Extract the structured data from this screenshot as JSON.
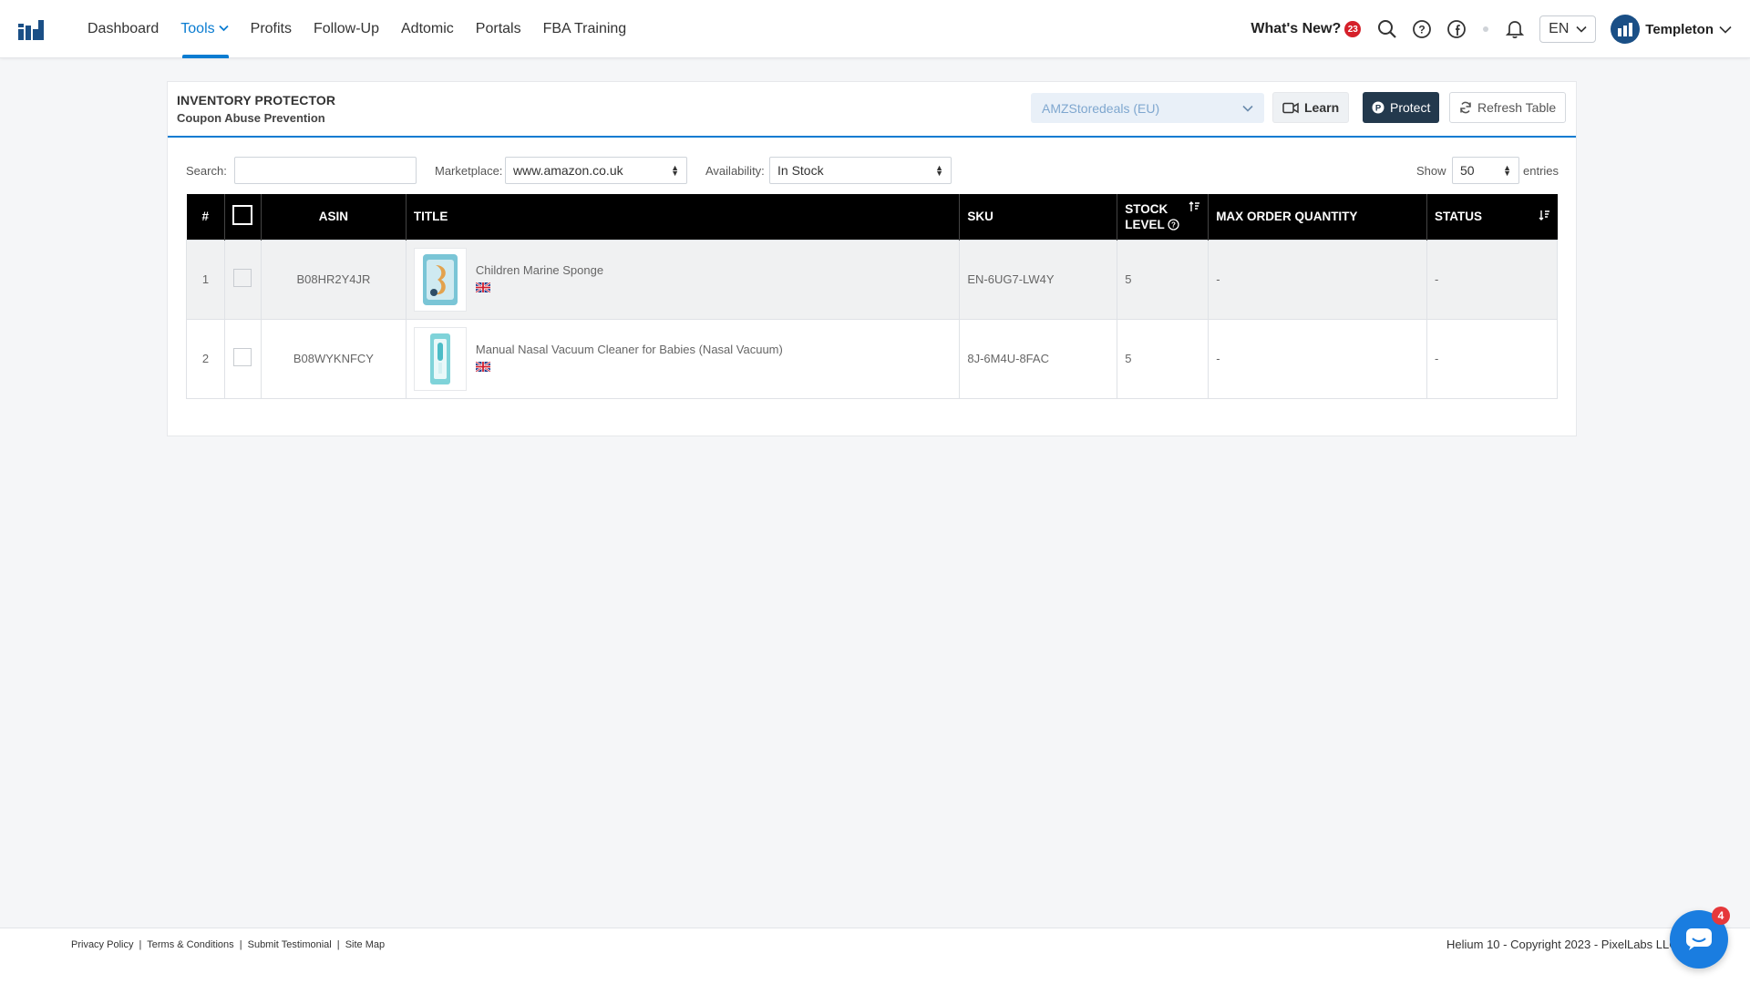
{
  "nav": {
    "items": [
      {
        "label": "Dashboard"
      },
      {
        "label": "Tools"
      },
      {
        "label": "Profits"
      },
      {
        "label": "Follow-Up"
      },
      {
        "label": "Adtomic"
      },
      {
        "label": "Portals"
      },
      {
        "label": "FBA Training"
      }
    ],
    "whats_new": "What's New?",
    "whats_new_count": "23",
    "lang": "EN",
    "user": "Templeton"
  },
  "panel": {
    "title": "INVENTORY PROTECTOR",
    "subtitle": "Coupon Abuse Prevention",
    "account": "AMZStoredeals (EU)",
    "learn": "Learn",
    "protect": "Protect",
    "refresh": "Refresh Table"
  },
  "controls": {
    "search_label": "Search:",
    "search_value": "",
    "marketplace_label": "Marketplace:",
    "marketplace_value": "www.amazon.co.uk",
    "availability_label": "Availability:",
    "availability_value": "In Stock",
    "show_label": "Show",
    "show_value": "50",
    "entries_label": "entries"
  },
  "table": {
    "headers": {
      "num": "#",
      "asin": "ASIN",
      "title": "TITLE",
      "sku": "SKU",
      "stock_1": "STOCK",
      "stock_2": "LEVEL",
      "max_order": "MAX ORDER QUANTITY",
      "status": "STATUS"
    },
    "rows": [
      {
        "num": "1",
        "asin": "B08HR2Y4JR",
        "title": "Children Marine Sponge",
        "sku": "EN-6UG7-LW4Y",
        "stock": "5",
        "max_order": "-",
        "status": "-"
      },
      {
        "num": "2",
        "asin": "B08WYKNFCY",
        "title": "Manual Nasal Vacuum Cleaner for Babies (Nasal Vacuum)",
        "sku": "8J-6M4U-8FAC",
        "stock": "5",
        "max_order": "-",
        "status": "-"
      }
    ]
  },
  "footer": {
    "privacy": "Privacy Policy",
    "terms": "Terms & Conditions",
    "testimonial": "Submit Testimonial",
    "sitemap": "Site Map",
    "separator": "|",
    "copyright": "Helium 10 - Copyright 2023 - PixelLabs LLC"
  },
  "chat": {
    "count": "4"
  }
}
